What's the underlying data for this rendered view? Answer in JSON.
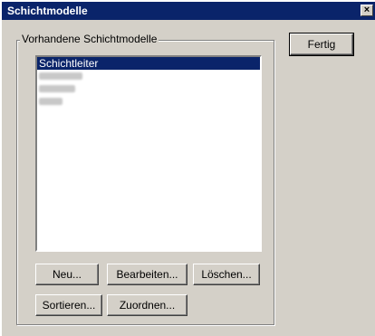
{
  "window": {
    "title": "Schichtmodelle",
    "close_label": "×"
  },
  "group": {
    "label": "Vorhandene Schichtmodelle"
  },
  "list": {
    "items": [
      {
        "label": "Schichtleiter",
        "selected": true
      },
      {
        "label": "",
        "selected": false,
        "blurred": true
      },
      {
        "label": "",
        "selected": false,
        "blurred": true
      },
      {
        "label": "",
        "selected": false,
        "blurred": true
      }
    ]
  },
  "buttons": {
    "done": "Fertig",
    "new": "Neu...",
    "edit": "Bearbeiten...",
    "delete": "Löschen...",
    "sort": "Sortieren...",
    "assign": "Zuordnen..."
  }
}
